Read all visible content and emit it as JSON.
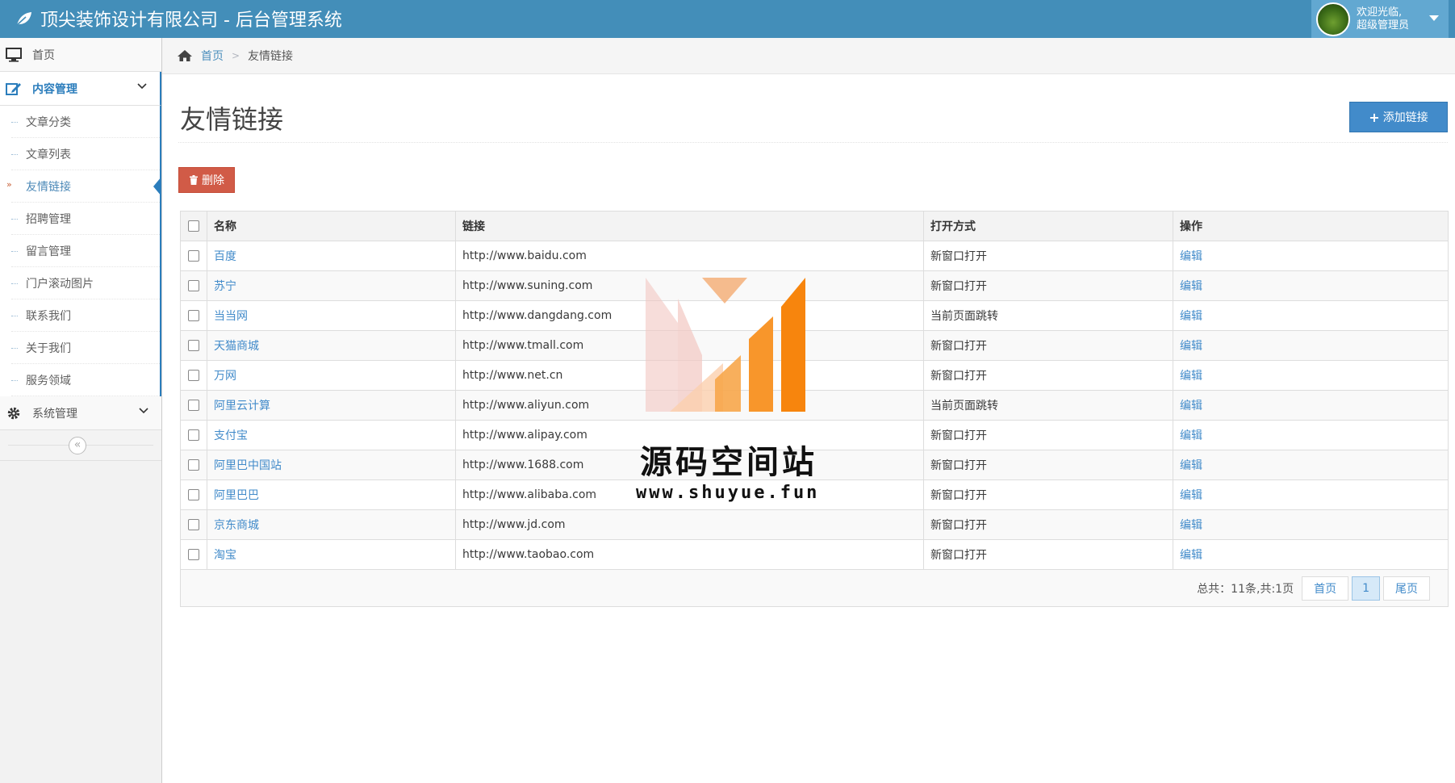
{
  "header": {
    "title": "顶尖装饰设计有限公司 - 后台管理系统",
    "welcome": "欢迎光临,",
    "role": "超级管理员"
  },
  "sidebar": {
    "home": "首页",
    "content_menu": "内容管理",
    "items": [
      "文章分类",
      "文章列表",
      "友情链接",
      "招聘管理",
      "留言管理",
      "门户滚动图片",
      "联系我们",
      "关于我们",
      "服务领域"
    ],
    "active_index": 2,
    "system_menu": "系统管理"
  },
  "breadcrumb": {
    "home": "首页",
    "current": "友情链接"
  },
  "page": {
    "title": "友情链接",
    "add_button": "添加链接",
    "delete_button": "删除"
  },
  "table": {
    "headers": [
      "名称",
      "链接",
      "打开方式",
      "操作"
    ],
    "rows": [
      {
        "name": "百度",
        "url": "http://www.baidu.com",
        "mode": "新窗口打开",
        "op": "编辑"
      },
      {
        "name": "苏宁",
        "url": "http://www.suning.com",
        "mode": "新窗口打开",
        "op": "编辑"
      },
      {
        "name": "当当网",
        "url": "http://www.dangdang.com",
        "mode": "当前页面跳转",
        "op": "编辑"
      },
      {
        "name": "天猫商城",
        "url": "http://www.tmall.com",
        "mode": "新窗口打开",
        "op": "编辑"
      },
      {
        "name": "万网",
        "url": "http://www.net.cn",
        "mode": "新窗口打开",
        "op": "编辑"
      },
      {
        "name": "阿里云计算",
        "url": "http://www.aliyun.com",
        "mode": "当前页面跳转",
        "op": "编辑"
      },
      {
        "name": "支付宝",
        "url": "http://www.alipay.com",
        "mode": "新窗口打开",
        "op": "编辑"
      },
      {
        "name": "阿里巴中国站",
        "url": "http://www.1688.com",
        "mode": "新窗口打开",
        "op": "编辑"
      },
      {
        "name": "阿里巴巴",
        "url": "http://www.alibaba.com",
        "mode": "新窗口打开",
        "op": "编辑"
      },
      {
        "name": "京东商城",
        "url": "http://www.jd.com",
        "mode": "新窗口打开",
        "op": "编辑"
      },
      {
        "name": "淘宝",
        "url": "http://www.taobao.com",
        "mode": "新窗口打开",
        "op": "编辑"
      }
    ]
  },
  "pagination": {
    "total": "总共：11条,共:1页",
    "first": "首页",
    "current": "1",
    "last": "尾页"
  },
  "watermark": {
    "line1": "源码空间站",
    "line2": "www.shuyue.fun"
  },
  "colors": {
    "navbar": "#438eb9",
    "accent": "#2b7dbc",
    "danger": "#d15b47",
    "primary": "#428bca"
  },
  "icons": {
    "brand": "leaf-icon",
    "home": "monitor-icon",
    "content": "edit-icon",
    "system": "gear-icon",
    "breadcrumb_home": "home-icon",
    "add": "plus-icon",
    "delete": "trash-icon"
  }
}
